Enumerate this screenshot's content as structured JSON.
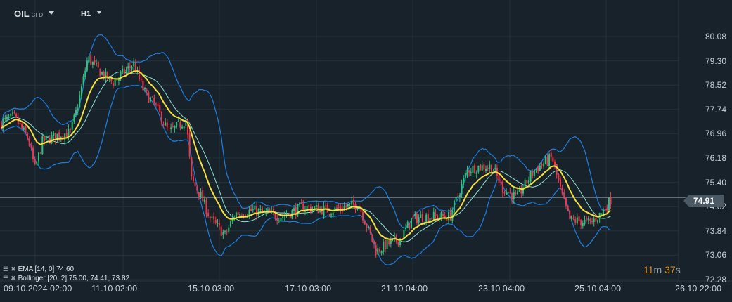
{
  "header": {
    "symbol": "OIL",
    "symbol_type": "CFD",
    "timeframe": "H1"
  },
  "legend": [
    {
      "text": "EMA [14, 0] 74.60"
    },
    {
      "text": "Bollinger  [20, 2] 75.00,  74.41,  73.82"
    }
  ],
  "current_price": "74.91",
  "timer": {
    "minutes": "11",
    "m": "m",
    "seconds": "37",
    "s": "s"
  },
  "colors": {
    "bg": "#18222a",
    "up": "#2ec27e",
    "down": "#f0364a",
    "ema": "#f5e13c",
    "bb": "#1f7fe0",
    "bb_mid": "#8fe3d4"
  },
  "chart_data": {
    "type": "candlestick",
    "y_ticks": [
      "80.08",
      "79.30",
      "78.52",
      "77.74",
      "76.96",
      "76.18",
      "75.40",
      "74.62",
      "73.84",
      "73.06",
      "72.28"
    ],
    "ylim": [
      72.28,
      80.08
    ],
    "x_ticks": [
      "09.10.2024  02:00",
      "11.10  02:00",
      "15.10  03:00",
      "17.10  03:00",
      "21.10  04:00",
      "23.10  04:00",
      "25.10  04:00",
      "26.10  22:00"
    ],
    "close_path": [
      [
        0,
        77.3
      ],
      [
        20,
        77.5
      ],
      [
        40,
        76.8
      ],
      [
        50,
        75.8
      ],
      [
        60,
        76.7
      ],
      [
        80,
        76.9
      ],
      [
        100,
        77.0
      ],
      [
        110,
        77.8
      ],
      [
        125,
        79.4
      ],
      [
        140,
        79.0
      ],
      [
        160,
        78.6
      ],
      [
        190,
        79.2
      ],
      [
        205,
        78.3
      ],
      [
        220,
        77.9
      ],
      [
        240,
        77.0
      ],
      [
        265,
        77.4
      ],
      [
        272,
        75.5
      ],
      [
        285,
        75.0
      ],
      [
        300,
        74.2
      ],
      [
        320,
        73.7
      ],
      [
        335,
        74.4
      ],
      [
        360,
        74.5
      ],
      [
        400,
        74.3
      ],
      [
        430,
        74.6
      ],
      [
        470,
        74.5
      ],
      [
        510,
        74.7
      ],
      [
        520,
        74.1
      ],
      [
        535,
        73.2
      ],
      [
        550,
        73.4
      ],
      [
        570,
        73.6
      ],
      [
        585,
        74.2
      ],
      [
        600,
        74.3
      ],
      [
        640,
        74.3
      ],
      [
        650,
        74.9
      ],
      [
        665,
        75.8
      ],
      [
        680,
        75.9
      ],
      [
        700,
        75.9
      ],
      [
        715,
        75.2
      ],
      [
        735,
        74.9
      ],
      [
        760,
        75.8
      ],
      [
        785,
        76.2
      ],
      [
        800,
        74.9
      ],
      [
        810,
        74.2
      ],
      [
        840,
        74.1
      ],
      [
        855,
        74.4
      ],
      [
        870,
        74.9
      ]
    ],
    "ema_period": 14,
    "bollinger": [
      20,
      2
    ]
  }
}
